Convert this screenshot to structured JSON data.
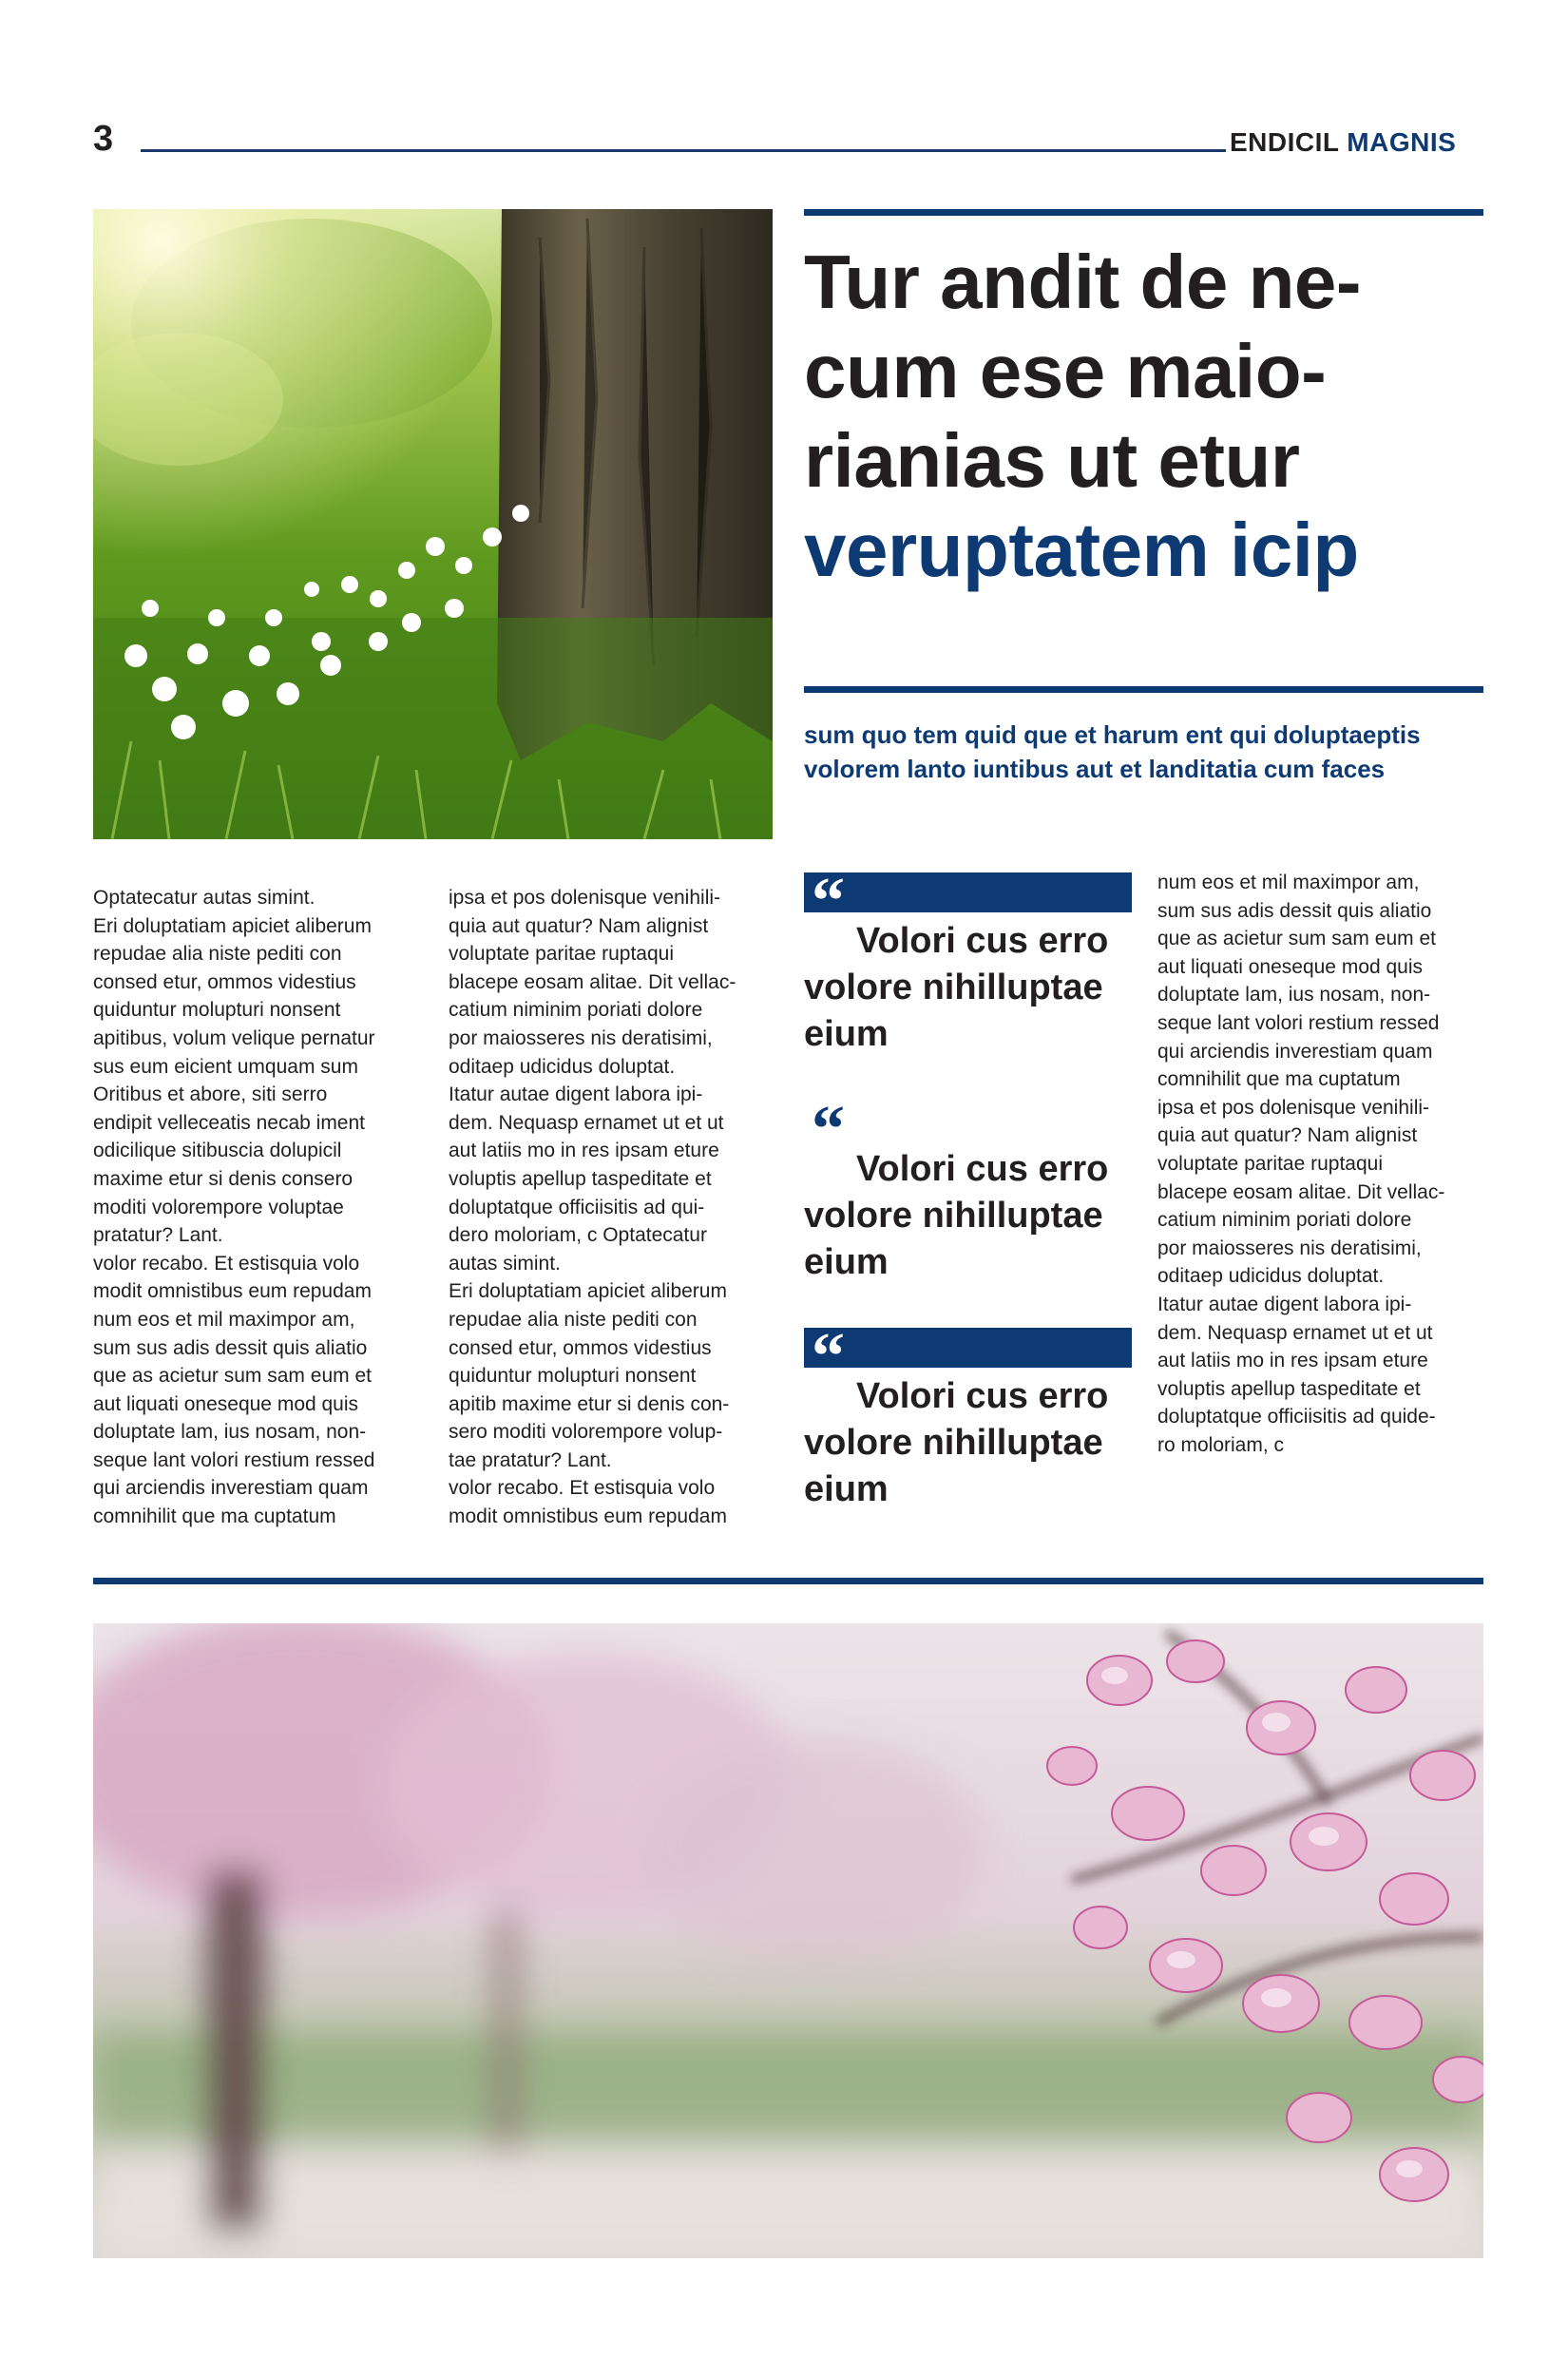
{
  "header": {
    "page_number": "3",
    "masthead_part1": "ENDICIL",
    "masthead_part2": "MAGNIS"
  },
  "images": {
    "top": "forest-meadow-with-white-flowers-and-tree-trunk",
    "bottom": "pink-magnolia-blossoms-in-park"
  },
  "headline": {
    "line1": "Tur andit de ne-",
    "line2": "cum ese maio-",
    "line3": "rianias ut etur",
    "line4": "veruptatem icip"
  },
  "deck": {
    "line1": "sum quo tem quid que et harum ent qui doluptaeptis",
    "line2": "volorem lanto iuntibus aut et landitatia cum faces"
  },
  "column1": [
    "Optatecatur autas simint.",
    "Eri doluptatiam apiciet aliberum",
    "repudae alia niste pediti con",
    "consed etur, ommos videstius",
    "quiduntur molupturi nonsent",
    "apitibus, volum velique pernatur",
    "sus eum eicient umquam sum",
    "Oritibus et abore, siti serro",
    "endipit velleceatis necab iment",
    "odicilique sitibuscia dolupicil",
    "maxime etur si denis consero",
    "moditi volorempore voluptae",
    "pratatur? Lant.",
    "volor recabo. Et estisquia volo",
    "modit omnistibus eum repudam",
    "num eos et mil maximpor am,",
    "sum sus adis dessit quis aliatio",
    "que as acietur sum sam eum et",
    "aut liquati oneseque mod quis",
    "doluptate lam, ius nosam, non-",
    "seque lant volori restium ressed",
    "qui arciendis inverestiam quam",
    "comnihilit que ma cuptatum"
  ],
  "column2": [
    "ipsa et pos dolenisque venihili-",
    "quia aut quatur? Nam alignist",
    "voluptate paritae ruptaqui",
    "blacepe eosam alitae. Dit vellac-",
    "catium niminim poriati dolore",
    "por maiosseres nis deratisimi,",
    "oditaep udicidus doluptat.",
    "Itatur autae digent labora ipi-",
    "dem. Nequasp ernamet ut et ut",
    "aut latiis mo in res ipsam eture",
    "voluptis apellup taspeditate et",
    "doluptatque officiisitis ad qui-",
    "dero moloriam, c Optatecatur",
    "autas simint.",
    "Eri doluptatiam apiciet aliberum",
    "repudae alia niste pediti con",
    "consed etur, ommos videstius",
    "quiduntur molupturi nonsent",
    "apitib maxime etur si denis con-",
    "sero moditi volorempore volup-",
    "tae pratatur? Lant.",
    "volor recabo. Et estisquia volo",
    "modit omnistibus eum repudam"
  ],
  "column4": [
    "num eos et mil maximpor am,",
    "sum sus adis dessit quis aliatio",
    "que as acietur sum sam eum et",
    "aut liquati oneseque mod quis",
    "doluptate lam, ius nosam, non-",
    "seque lant volori restium ressed",
    "qui arciendis inverestiam quam",
    "comnihilit que ma cuptatum",
    "ipsa et pos dolenisque venihili-",
    "quia aut quatur? Nam alignist",
    "voluptate paritae ruptaqui",
    "blacepe eosam alitae. Dit vellac-",
    "catium niminim poriati dolore",
    "por maiosseres nis deratisimi,",
    "oditaep udicidus doluptat.",
    "Itatur autae digent labora ipi-",
    "dem. Nequasp ernamet ut et ut",
    "aut latiis mo in res ipsam eture",
    "voluptis apellup taspeditate et",
    "doluptatque officiisitis ad quide-",
    "ro moloriam, c"
  ],
  "pull_quotes": [
    {
      "mark": "“",
      "line1": "Volori cus erro",
      "line2": "volore nihilluptae",
      "line3": "eium"
    },
    {
      "mark": "“",
      "line1": "Volori cus erro",
      "line2": "volore nihilluptae",
      "line3": "eium"
    },
    {
      "mark": "“",
      "line1": "Volori cus erro",
      "line2": "volore nihilluptae",
      "line3": "eium"
    }
  ],
  "colors": {
    "accent": "#0d3a73",
    "text": "#231f20"
  }
}
